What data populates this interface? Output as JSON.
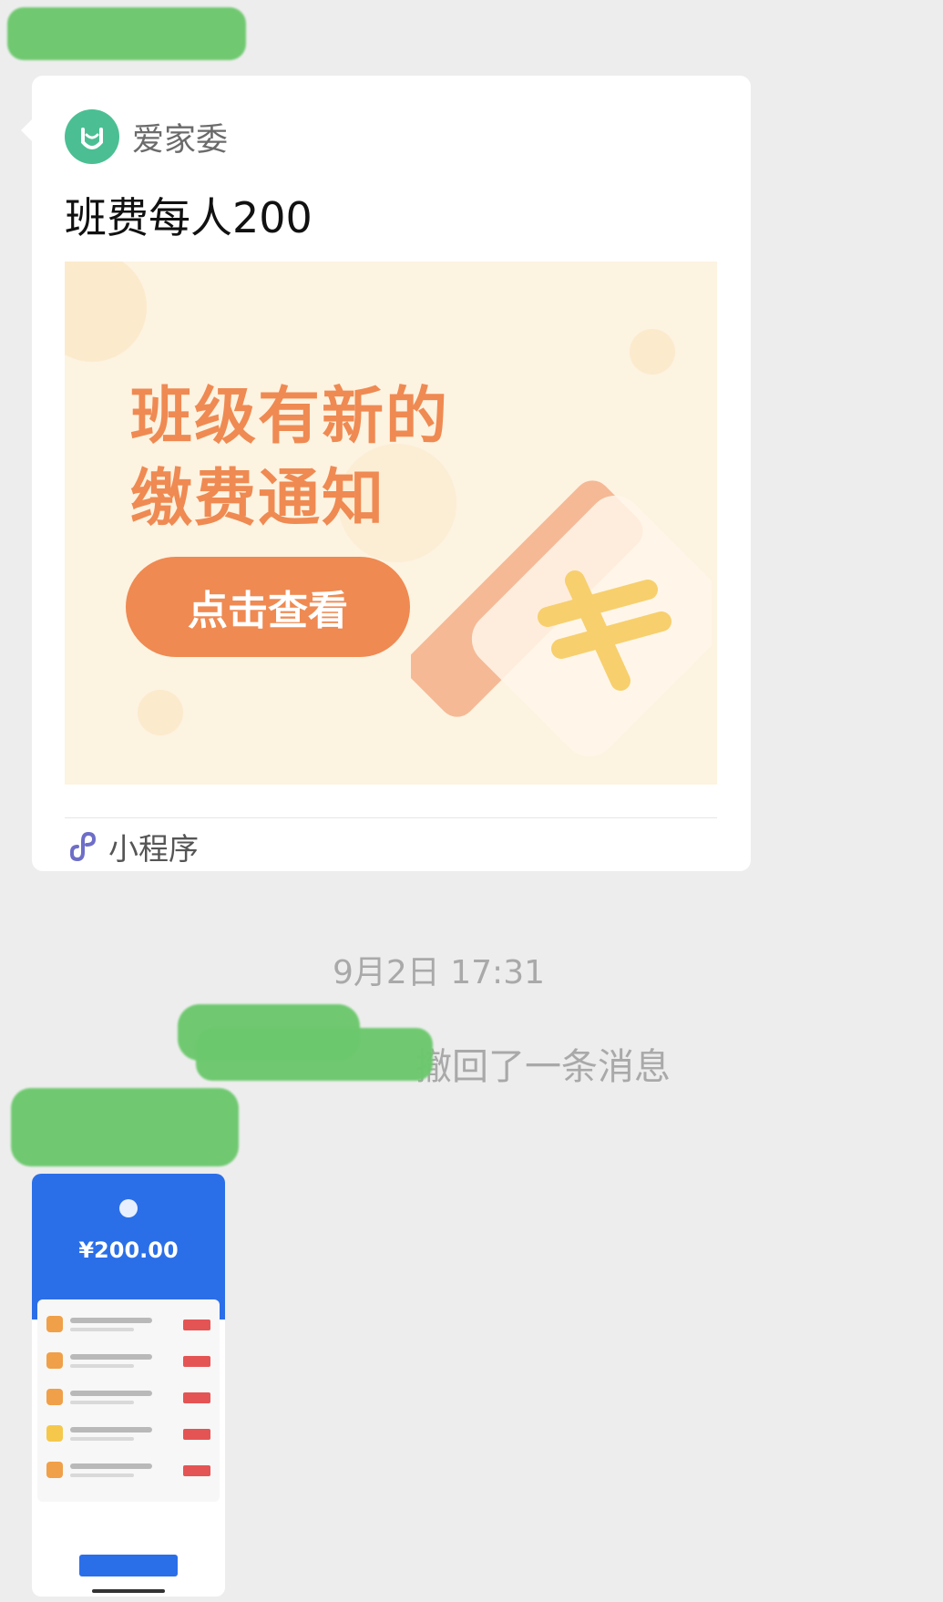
{
  "card": {
    "app_name": "爱家委",
    "title": "班费每人200",
    "banner": {
      "headline_line1": "班级有新的",
      "headline_line2": "缴费通知",
      "button_label": "点击查看"
    },
    "footer_label": "小程序"
  },
  "timestamp": "9月2日 17:31",
  "recall_message": "撤回了一条消息",
  "screenshot_thumb": {
    "amount": "¥200.00"
  },
  "colors": {
    "bubble_bg": "#ffffff",
    "chat_bg": "#ededed",
    "accent_orange": "#ef8a52",
    "logo_green": "#4bbf93",
    "screenshot_blue": "#2b6fe8"
  }
}
